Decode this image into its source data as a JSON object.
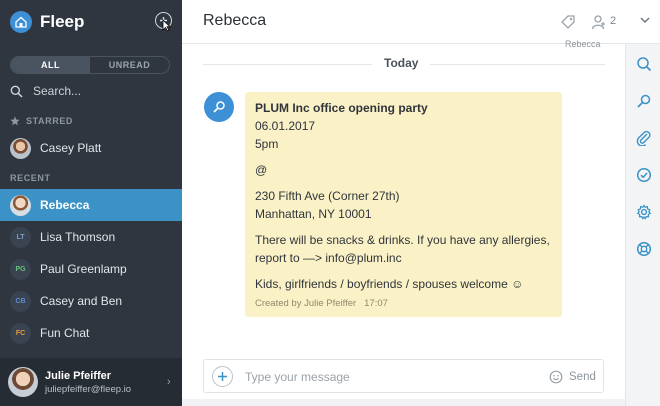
{
  "app": {
    "name": "Fleep"
  },
  "sidebar": {
    "filters": {
      "all": "ALL",
      "unread": "UNREAD"
    },
    "search_placeholder": "Search...",
    "starred_label": "STARRED",
    "starred": [
      {
        "name": "Casey Platt"
      }
    ],
    "recent_label": "RECENT",
    "recent": [
      {
        "name": "Rebecca",
        "initials": "",
        "selected": true
      },
      {
        "name": "Lisa Thomson",
        "initials": "LT",
        "color": "#7f9ccf"
      },
      {
        "name": "Paul Greenlamp",
        "initials": "PG",
        "color": "#67c27a"
      },
      {
        "name": "Casey and Ben",
        "initials": "CB",
        "color": "#5b8bd6"
      },
      {
        "name": "Fun Chat",
        "initials": "FC",
        "color": "#e89a3c"
      }
    ],
    "user": {
      "name": "Julie Pfeiffer",
      "email": "juliepfeiffer@fleep.io"
    }
  },
  "header": {
    "title": "Rebecca",
    "member_count": "2"
  },
  "chat": {
    "partial_name": "Rebecca",
    "date_divider": "Today",
    "message": {
      "title": "PLUM Inc office opening party",
      "date": "06.01.2017",
      "time": "5pm",
      "at": "@",
      "address1": "230 Fifth Ave (Corner 27th)",
      "address2": "Manhattan, NY 10001",
      "note1": "There will be snacks & drinks. If you have any allergies,",
      "note2": "report to —>  info@plum.inc",
      "note3": "Kids, girlfriends / boyfriends / spouses welcome ☺",
      "meta_author": "Created by Julie Pfeiffer",
      "meta_time": "17:07"
    }
  },
  "composer": {
    "placeholder": "Type your message",
    "send_label": "Send"
  },
  "colors": {
    "sidebar_bg": "#2f3640",
    "accent": "#3a92c6",
    "note_bg": "#fbf1c7"
  }
}
